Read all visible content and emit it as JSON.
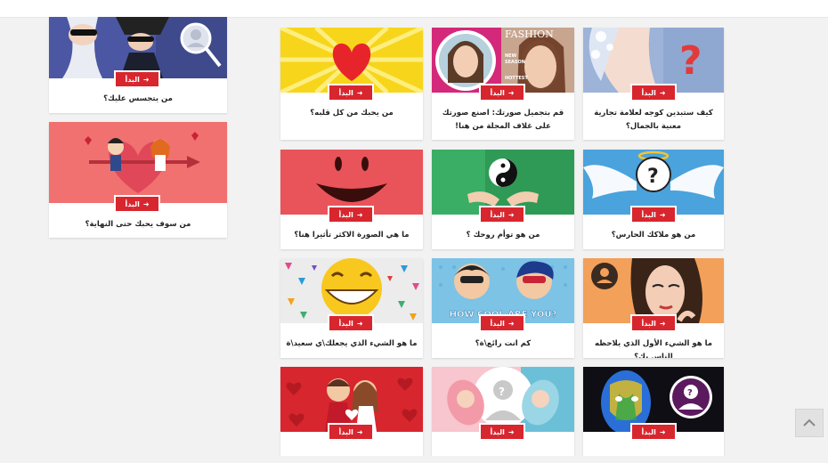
{
  "ui": {
    "start_label": "البدأ",
    "arrow_glyph": "➜",
    "scroll_top_glyph": "^"
  },
  "sidebar_cards": [
    {
      "title": "من يتجسس عليك؟",
      "icon": "spy-couple-image"
    },
    {
      "title": "من سوف يحبك حتى النهاية؟",
      "icon": "cupid-couple-image"
    }
  ],
  "grid_cards": [
    {
      "title": "من يحبك من كل قلبه؟",
      "icon": "heart-image"
    },
    {
      "title": "قم بتجميل صورتك: اصنع صورتك على غلاف المجلة من هنا!",
      "icon": "magazine-cover-image",
      "magazine": "FASHION",
      "magazine_lines": [
        "NEW",
        "SEASON",
        "HOTTEST"
      ]
    },
    {
      "title": "كيف ستبدين كوجه لعلامة تجارية معنية بالجمال؟",
      "icon": "beauty-face-image"
    },
    {
      "title": "ما هي الصورة الاكثر تأثيرا هنا؟",
      "icon": "smile-face-image"
    },
    {
      "title": "من هو توأم روحك ؟",
      "icon": "yin-yang-image"
    },
    {
      "title": "من هو ملاكك الحارس؟",
      "icon": "angel-wings-image"
    },
    {
      "title": "ما هو الشيء الذي يجعلك\\ي سعيد\\ة",
      "icon": "laughing-emoji-image"
    },
    {
      "title": "كم انت رائع\\ة؟",
      "icon": "how-cool-image",
      "banner": "HOW COOL ARE YOU?"
    },
    {
      "title": "ما هو الشيء الأول الذي يلاحظه الناس بك؟",
      "icon": "woman-portrait-image"
    },
    {
      "title": "",
      "icon": "couple-hearts-image"
    },
    {
      "title": "",
      "icon": "baby-faces-image"
    },
    {
      "title": "",
      "icon": "painted-face-image"
    }
  ],
  "colors": {
    "accent": "#d8262e",
    "background": "#f2f2f2",
    "card": "#ffffff"
  }
}
